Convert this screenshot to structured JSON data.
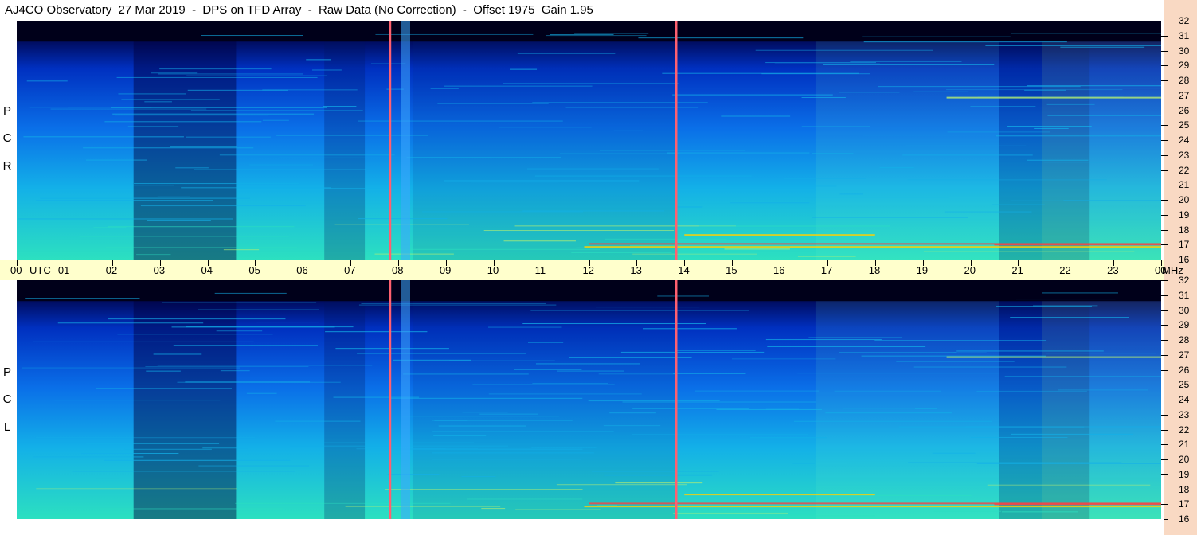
{
  "header": {
    "title": "AJ4CO Observatory  27 Mar 2019  -  DPS on TFD Array  -  Raw Data (No Correction)  -  Offset 1975  Gain 1.95"
  },
  "panels": {
    "rcp_letters": [
      "R",
      "C",
      "P"
    ],
    "lcp_letters": [
      "L",
      "C",
      "P"
    ]
  },
  "chart_data": {
    "type": "heatmap",
    "title": "AJ4CO Observatory  27 Mar 2019  -  DPS on TFD Array  -  Raw Data (No Correction)  -  Offset 1975  Gain 1.95",
    "x_unit_label": "UTC",
    "y_unit_label": "MHz",
    "x_ticks": [
      "00",
      "01",
      "02",
      "03",
      "04",
      "05",
      "06",
      "07",
      "08",
      "09",
      "10",
      "11",
      "12",
      "13",
      "14",
      "15",
      "16",
      "17",
      "18",
      "19",
      "20",
      "21",
      "22",
      "23",
      "00"
    ],
    "y_ticks": [
      32,
      31,
      30,
      29,
      28,
      27,
      26,
      25,
      24,
      23,
      22,
      21,
      20,
      19,
      18,
      17,
      16
    ],
    "xlim_hours": [
      0,
      24
    ],
    "ylim_mhz": [
      16,
      32
    ],
    "panels": [
      "RCP",
      "LCP"
    ],
    "colormap": [
      "#00001a",
      "#000a5a",
      "#0030c0",
      "#0a6fe8",
      "#13b0e8",
      "#2ce0c0",
      "#b8f070",
      "#ffd000",
      "#ff4040"
    ],
    "markers_hours": [
      7.82,
      13.82
    ],
    "marker_color": "#ff6070"
  }
}
